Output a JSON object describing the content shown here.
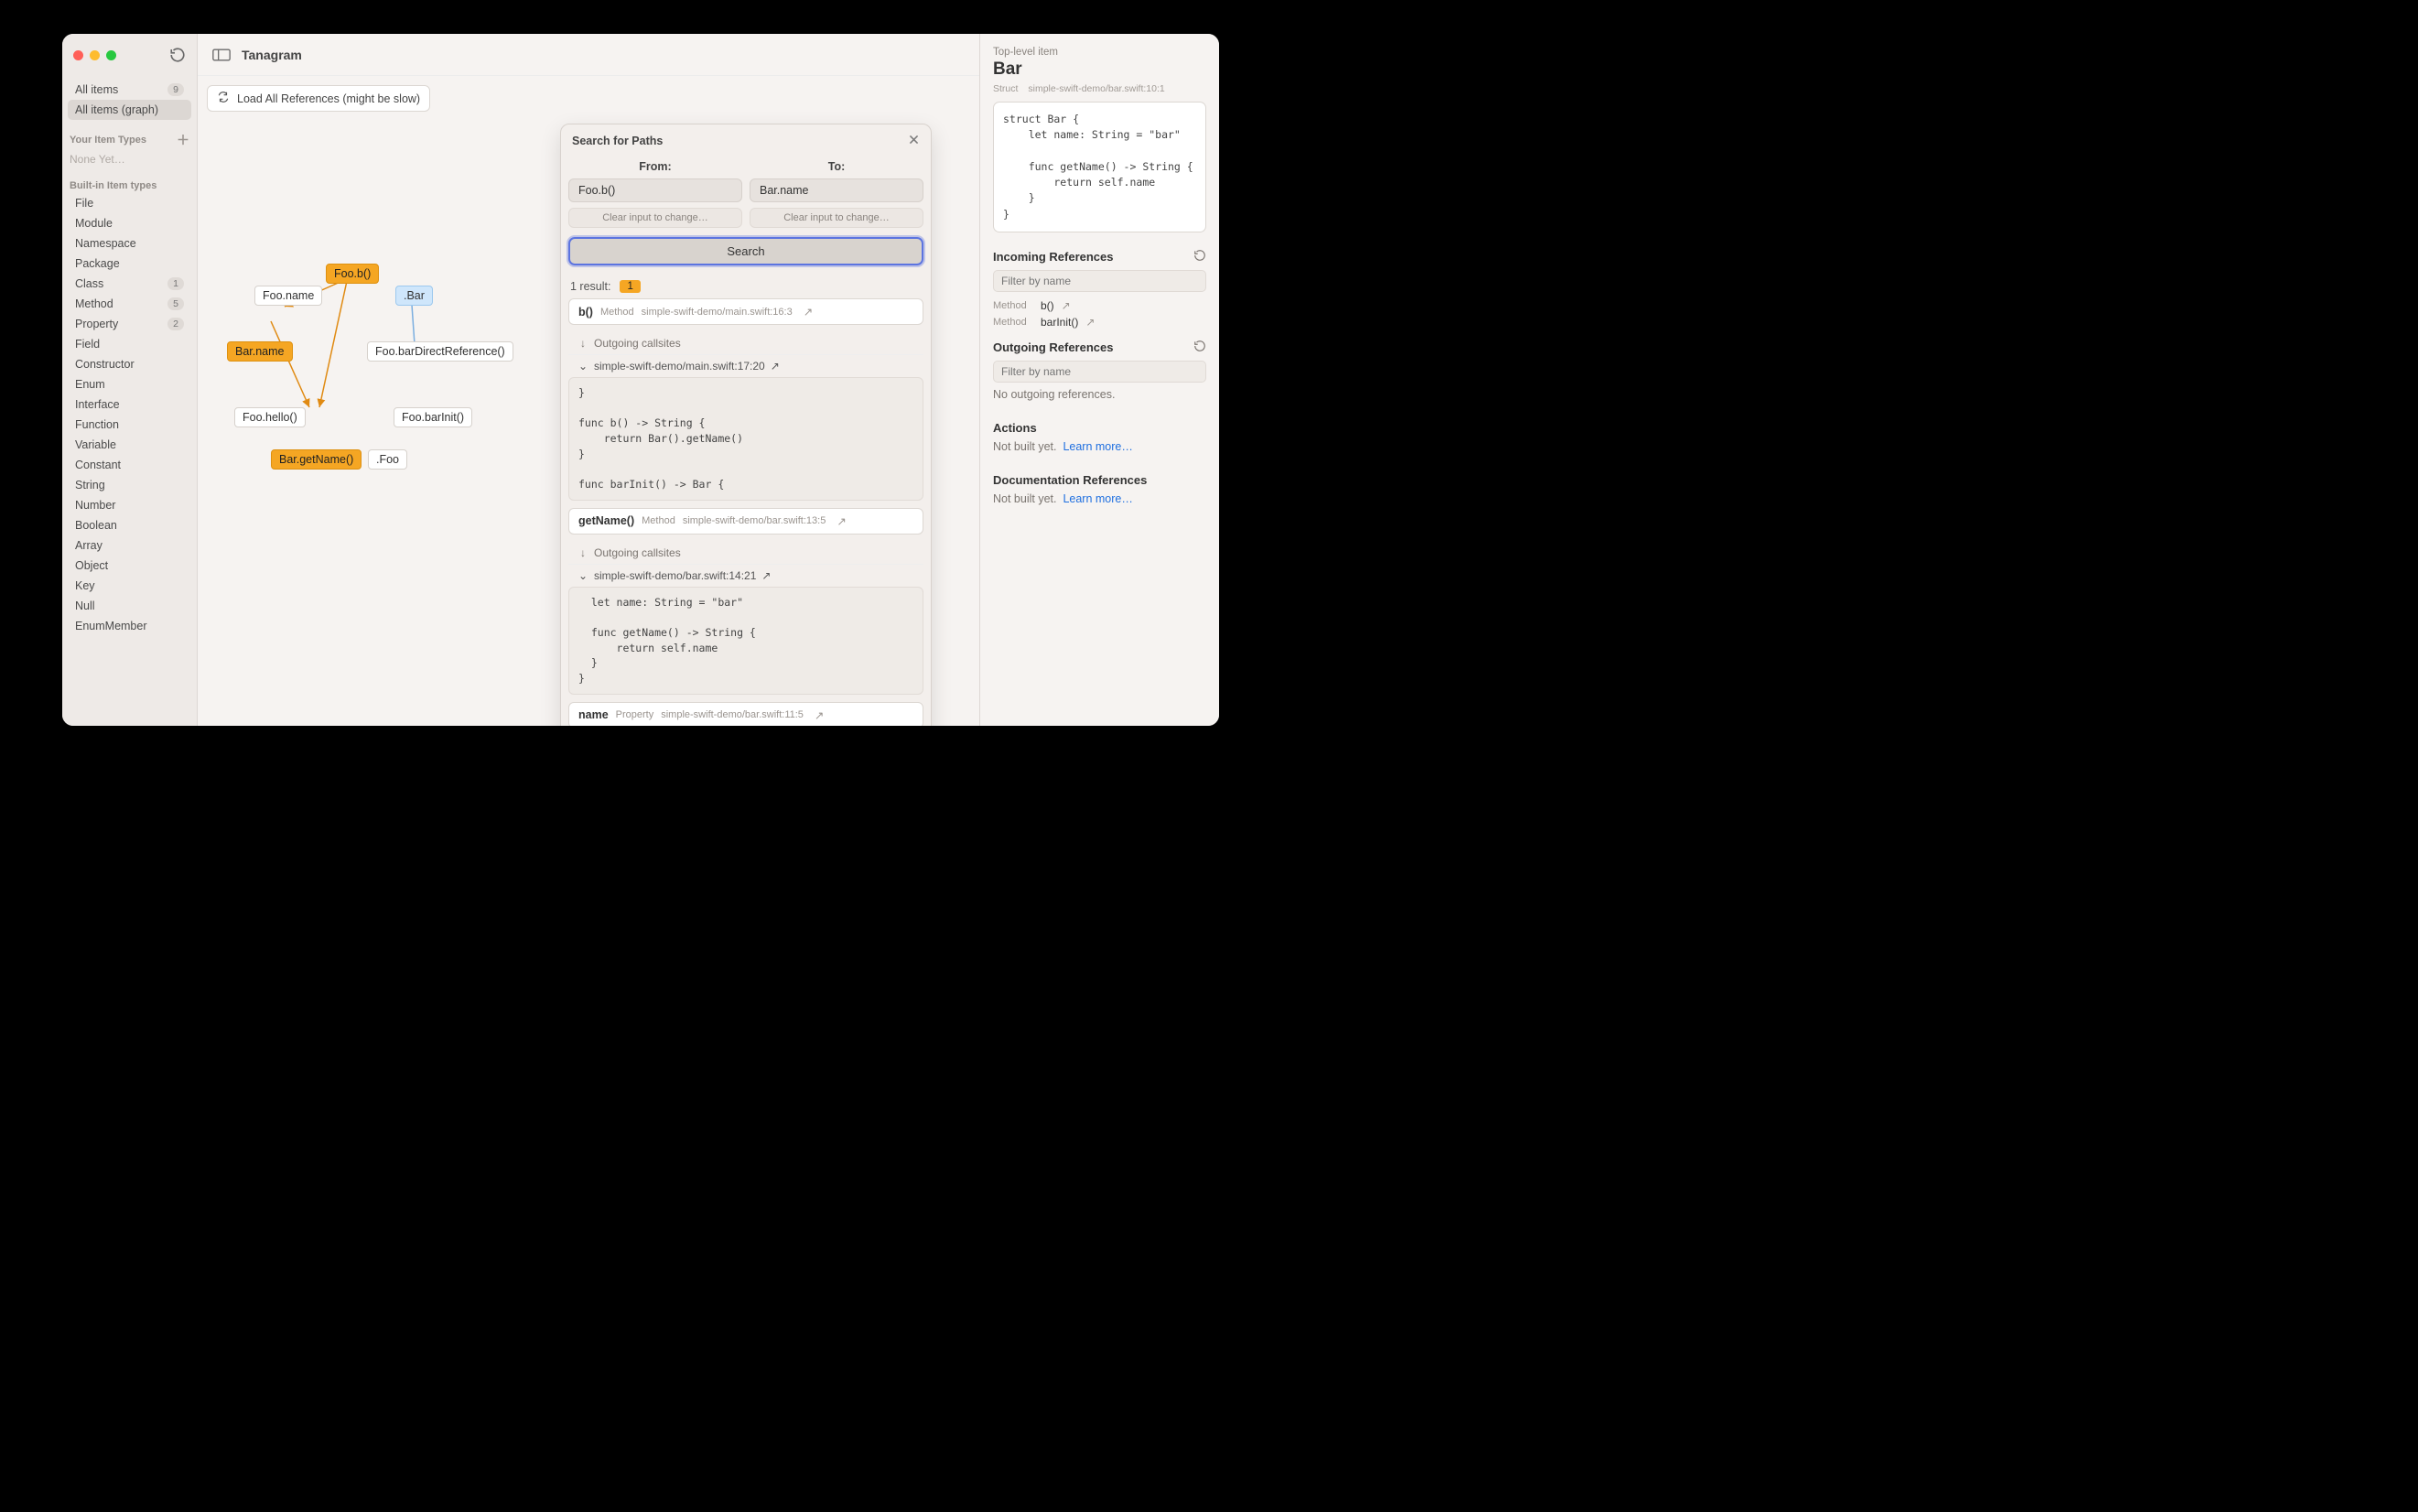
{
  "app": {
    "title": "Tanagram"
  },
  "sidebar": {
    "views": [
      {
        "label": "All items",
        "count": "9",
        "selected": false
      },
      {
        "label": "All items (graph)",
        "count": "",
        "selected": true
      }
    ],
    "yourTypes": {
      "heading": "Your Item Types",
      "none": "None Yet…"
    },
    "builtin": {
      "heading": "Built-in Item types",
      "items": [
        {
          "label": "File",
          "count": ""
        },
        {
          "label": "Module",
          "count": ""
        },
        {
          "label": "Namespace",
          "count": ""
        },
        {
          "label": "Package",
          "count": ""
        },
        {
          "label": "Class",
          "count": "1"
        },
        {
          "label": "Method",
          "count": "5"
        },
        {
          "label": "Property",
          "count": "2"
        },
        {
          "label": "Field",
          "count": ""
        },
        {
          "label": "Constructor",
          "count": ""
        },
        {
          "label": "Enum",
          "count": ""
        },
        {
          "label": "Interface",
          "count": ""
        },
        {
          "label": "Function",
          "count": ""
        },
        {
          "label": "Variable",
          "count": ""
        },
        {
          "label": "Constant",
          "count": ""
        },
        {
          "label": "String",
          "count": ""
        },
        {
          "label": "Number",
          "count": ""
        },
        {
          "label": "Boolean",
          "count": ""
        },
        {
          "label": "Array",
          "count": ""
        },
        {
          "label": "Object",
          "count": ""
        },
        {
          "label": "Key",
          "count": ""
        },
        {
          "label": "Null",
          "count": ""
        },
        {
          "label": "EnumMember",
          "count": ""
        }
      ]
    }
  },
  "canvas": {
    "loadRefs": "Load All References (might be slow)",
    "nodes": {
      "fooB": "Foo.b()",
      "fooName": "Foo.name",
      "bar": ".Bar",
      "barName": "Bar.name",
      "fooBarDirectRef": "Foo.barDirectReference()",
      "fooHello": "Foo.hello()",
      "fooBarInit": "Foo.barInit()",
      "barGetName": "Bar.getName()",
      "foo": ".Foo"
    }
  },
  "search": {
    "title": "Search for Paths",
    "fromLabel": "From:",
    "toLabel": "To:",
    "fromValue": "Foo.b()",
    "toValue": "Bar.name",
    "fromHint": "Clear input to change…",
    "toHint": "Clear input to change…",
    "searchBtn": "Search",
    "resultsHdr": "1 result:",
    "resultsCount": "1",
    "r1": {
      "sym": "b()",
      "kind": "Method",
      "loc": "simple-swift-demo/main.swift:16:3",
      "outgoing": "Outgoing callsites",
      "file": "simple-swift-demo/main.swift:17:20",
      "code": "}\n\nfunc b() -> String {\n    return Bar().getName()\n}\n\nfunc barInit() -> Bar {"
    },
    "r2": {
      "sym": "getName()",
      "kind": "Method",
      "loc": "simple-swift-demo/bar.swift:13:5",
      "outgoing": "Outgoing callsites",
      "file": "simple-swift-demo/bar.swift:14:21",
      "code": "  let name: String = \"bar\"\n\n  func getName() -> String {\n      return self.name\n  }\n}"
    },
    "r3": {
      "sym": "name",
      "kind": "Property",
      "loc": "simple-swift-demo/bar.swift:11:5"
    }
  },
  "inspector": {
    "top": "Top-level item",
    "title": "Bar",
    "kind": "Struct",
    "loc": "simple-swift-demo/bar.swift:10:1",
    "code": "struct Bar {\n    let name: String = \"bar\"\n\n    func getName() -> String {\n        return self.name\n    }\n}",
    "incoming": {
      "heading": "Incoming References",
      "filter": "Filter by name",
      "items": [
        {
          "kind": "Method",
          "sym": "b()"
        },
        {
          "kind": "Method",
          "sym": "barInit()"
        }
      ]
    },
    "outgoing": {
      "heading": "Outgoing References",
      "filter": "Filter by name",
      "empty": "No outgoing references."
    },
    "actions": {
      "heading": "Actions",
      "text": "Not built yet.",
      "link": "Learn more…"
    },
    "docs": {
      "heading": "Documentation References",
      "text": "Not built yet.",
      "link": "Learn more…"
    }
  }
}
